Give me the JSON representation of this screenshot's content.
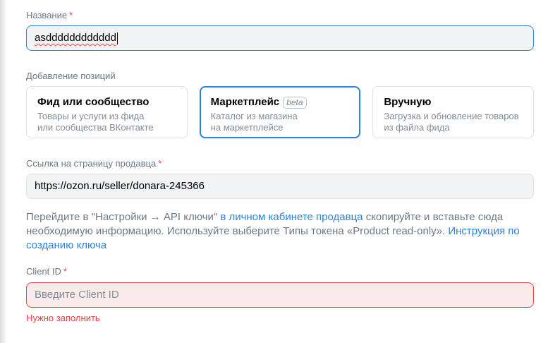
{
  "form": {
    "name_field": {
      "label": "Название",
      "required_mark": "*",
      "value": "asdddddddddddd"
    },
    "positions": {
      "label": "Добавление позиций",
      "options": [
        {
          "title": "Фид или сообщество",
          "desc_line1": "Товары и услуги из фида",
          "desc_line2": "или сообщества ВКонтакте",
          "selected": false
        },
        {
          "title": "Маркетплейс",
          "badge": "beta",
          "desc_line1": "Каталог из магазина",
          "desc_line2": "на маркетплейсе",
          "selected": true
        },
        {
          "title": "Вручную",
          "desc_line1": "Загрузка и обновление товаров",
          "desc_line2": "из файла фида",
          "selected": false
        }
      ]
    },
    "seller_link": {
      "label": "Ссылка на страницу продавца",
      "required_mark": "*",
      "value": "https://ozon.ru/seller/donara-245366"
    },
    "hint": {
      "part1": "Перейдите в \"Настройки → API ключи\" ",
      "link1": "в личном кабинете продавца",
      "part2": " скопируйте и вставьте сюда необходимую информацию. Используйте выберите Типы токена «Product read-only». ",
      "link2": "Инструкция по созданию ключа"
    },
    "client_id": {
      "label": "Client ID",
      "required_mark": "*",
      "placeholder": "Введите Client ID",
      "error": "Нужно заполнить"
    }
  },
  "colors": {
    "accent": "#2d81e0",
    "error": "#e64646",
    "error_bg": "#faebeb",
    "input_bg": "#f2f3f5",
    "muted_text": "#6d7885",
    "secondary_text": "#818c99",
    "border": "#dce1e6"
  }
}
